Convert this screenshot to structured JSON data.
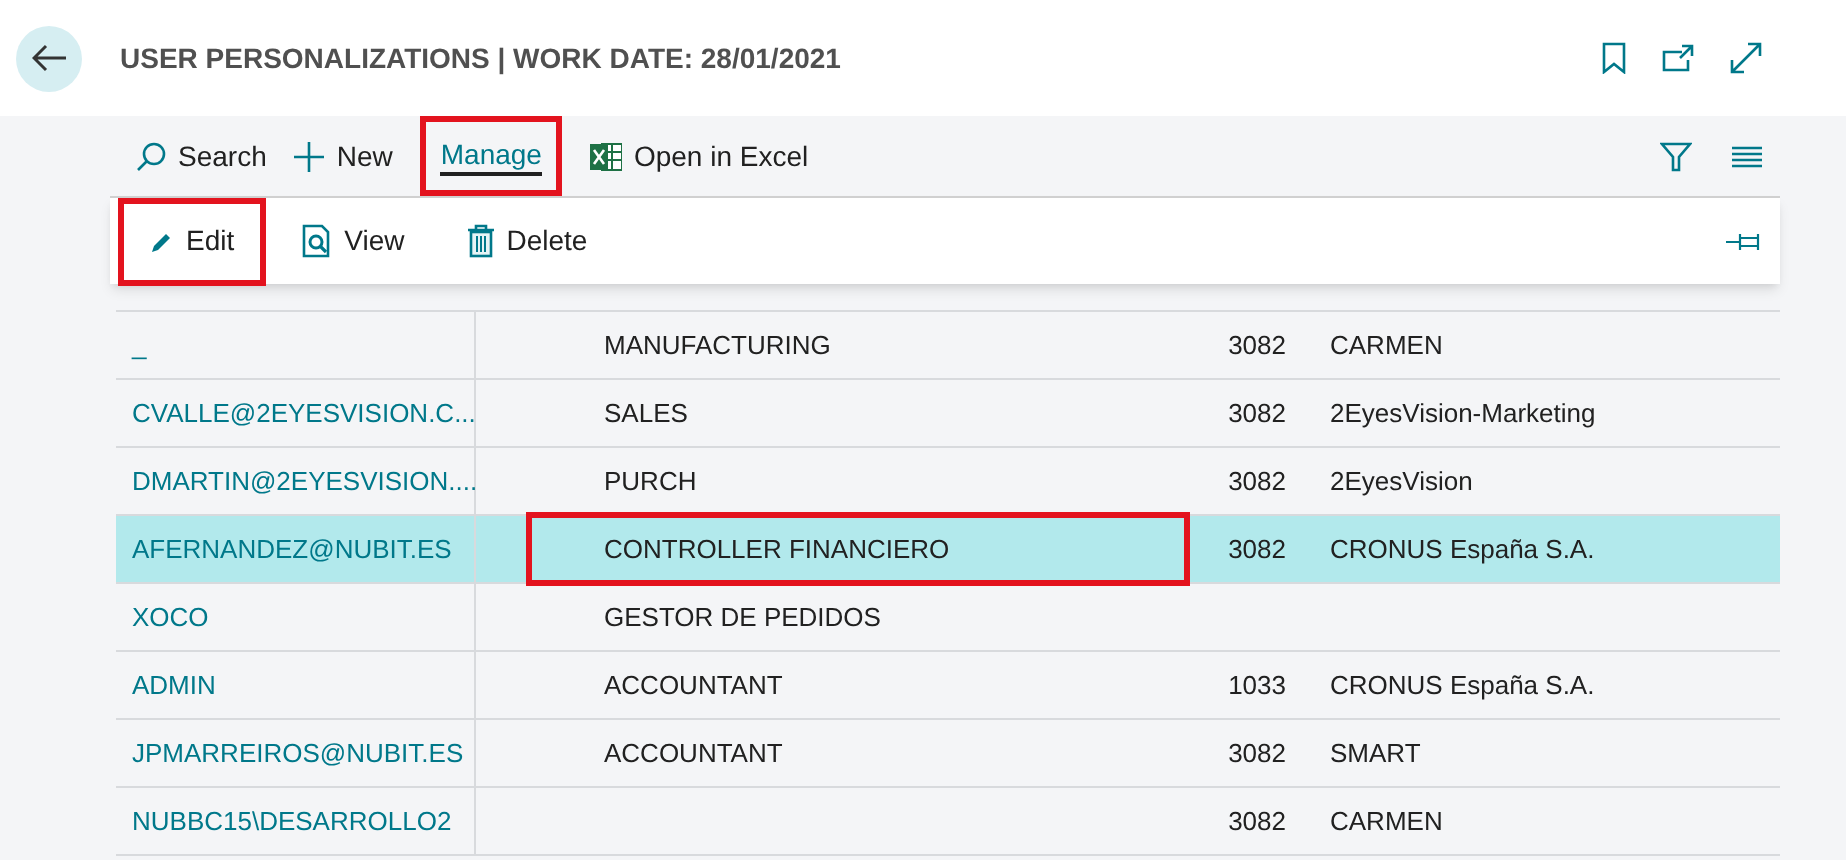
{
  "header": {
    "title": "USER PERSONALIZATIONS | WORK DATE: 28/01/2021"
  },
  "action_bar": [
    {
      "kind": "search",
      "label": "Search",
      "selected": false,
      "annotated": false
    },
    {
      "kind": "new",
      "label": "New",
      "selected": false,
      "annotated": false
    },
    {
      "kind": "tab",
      "label": "Manage",
      "selected": true,
      "annotated": true
    },
    {
      "kind": "excel",
      "label": "Open in Excel",
      "selected": false,
      "annotated": false
    }
  ],
  "menu": [
    {
      "kind": "edit",
      "label": "Edit",
      "annotated": true
    },
    {
      "kind": "view",
      "label": "View",
      "annotated": false
    },
    {
      "kind": "delete",
      "label": "Delete",
      "annotated": false
    }
  ],
  "rows": [
    {
      "user": "_",
      "profile": "MANUFACTURING",
      "language": "3082",
      "company": "CARMEN",
      "selected": false
    },
    {
      "user": "CVALLE@2EYESVISION.C...",
      "profile": "SALES",
      "language": "3082",
      "company": "2EyesVision-Marketing",
      "selected": false
    },
    {
      "user": "DMARTIN@2EYESVISION....",
      "profile": "PURCH",
      "language": "3082",
      "company": "2EyesVision",
      "selected": false
    },
    {
      "user": "AFERNANDEZ@NUBIT.ES",
      "profile": "CONTROLLER FINANCIERO",
      "language": "3082",
      "company": "CRONUS España S.A.",
      "selected": true,
      "profile_annotated": true
    },
    {
      "user": "XOCO",
      "profile": "GESTOR DE PEDIDOS",
      "selected": false
    },
    {
      "user": "ADMIN",
      "profile": "ACCOUNTANT",
      "language": "1033",
      "company": "CRONUS España S.A.",
      "selected": false
    },
    {
      "user": "JPMARREIROS@NUBIT.ES",
      "profile": "ACCOUNTANT",
      "language": "3082",
      "company": "SMART",
      "selected": false
    },
    {
      "user": "NUBBC15\\DESARROLLO2",
      "language": "3082",
      "company": "CARMEN",
      "selected": false
    }
  ]
}
